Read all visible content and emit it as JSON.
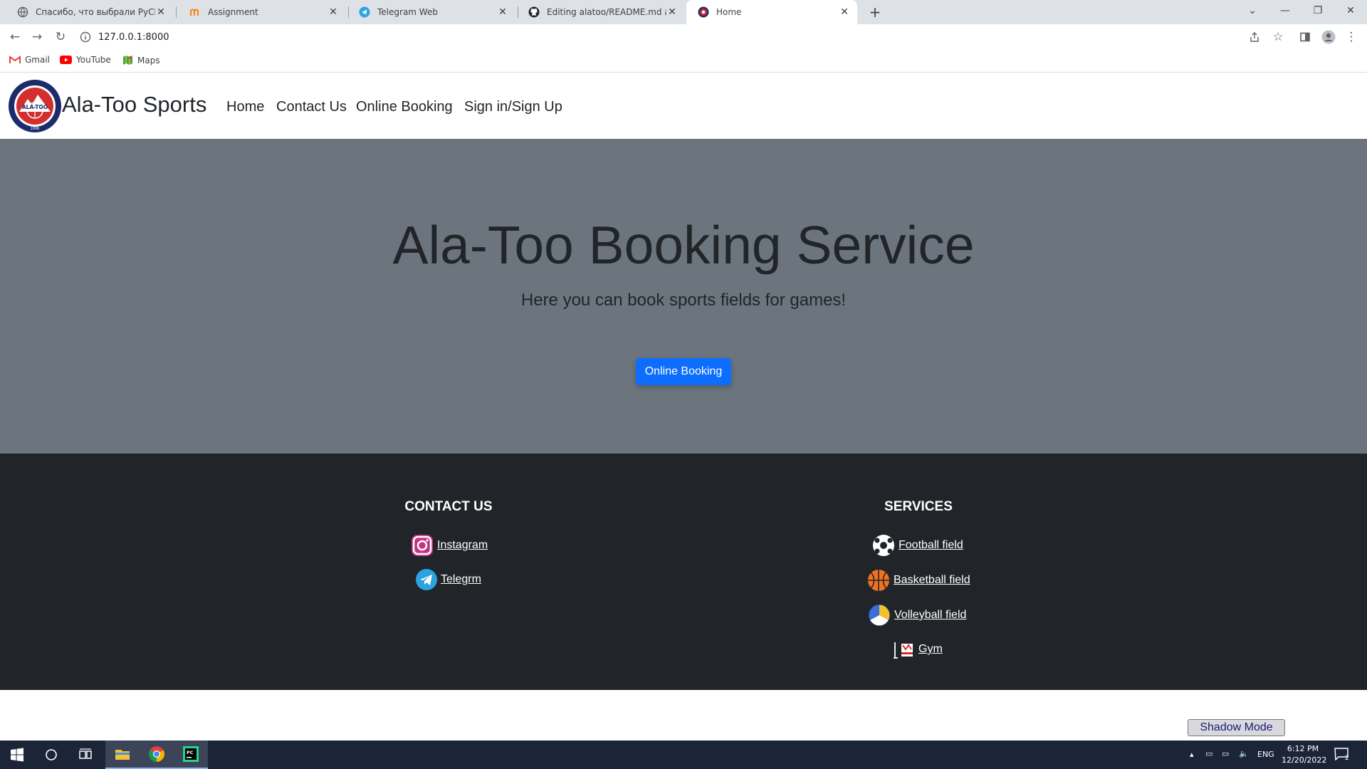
{
  "browser": {
    "tabs": [
      {
        "title": "Спасибо, что выбрали PyCharm",
        "icon": "globe-icon"
      },
      {
        "title": "Assignment",
        "icon": "moodle-icon"
      },
      {
        "title": "Telegram Web",
        "icon": "telegram-icon"
      },
      {
        "title": "Editing alatoo/README.md at ma",
        "icon": "github-icon"
      },
      {
        "title": "Home",
        "icon": "alatoo-logo-icon",
        "active": true
      }
    ],
    "url": "127.0.0.1:8000",
    "bookmarks": [
      "Gmail",
      "YouTube",
      "Maps"
    ]
  },
  "site": {
    "brand": "Ala-Too Sports",
    "logo_text": "ALA-TOO",
    "logo_year": "1996",
    "nav": [
      "Home",
      "Contact Us",
      "Online Booking",
      "Sign in/Sign Up"
    ],
    "hero": {
      "title": "Ala-Too Booking Service",
      "subtitle": "Here you can book sports fields for games!",
      "button": "Online Booking"
    },
    "footer": {
      "contact_heading": "CONTACT US",
      "contact_links": [
        "Instagram",
        "Telegrm"
      ],
      "services_heading": "SERVICES",
      "service_links": [
        "Football field",
        "Basketball field",
        "Volleyball field",
        "Gym"
      ]
    },
    "shadow_mode": "Shadow Mode"
  },
  "taskbar": {
    "lang": "ENG",
    "time": "6:12 PM",
    "date": "12/20/2022",
    "notifications": "2"
  },
  "colors": {
    "hero_bg": "#6c757d",
    "footer_bg": "#212529",
    "primary": "#0d6efd"
  }
}
